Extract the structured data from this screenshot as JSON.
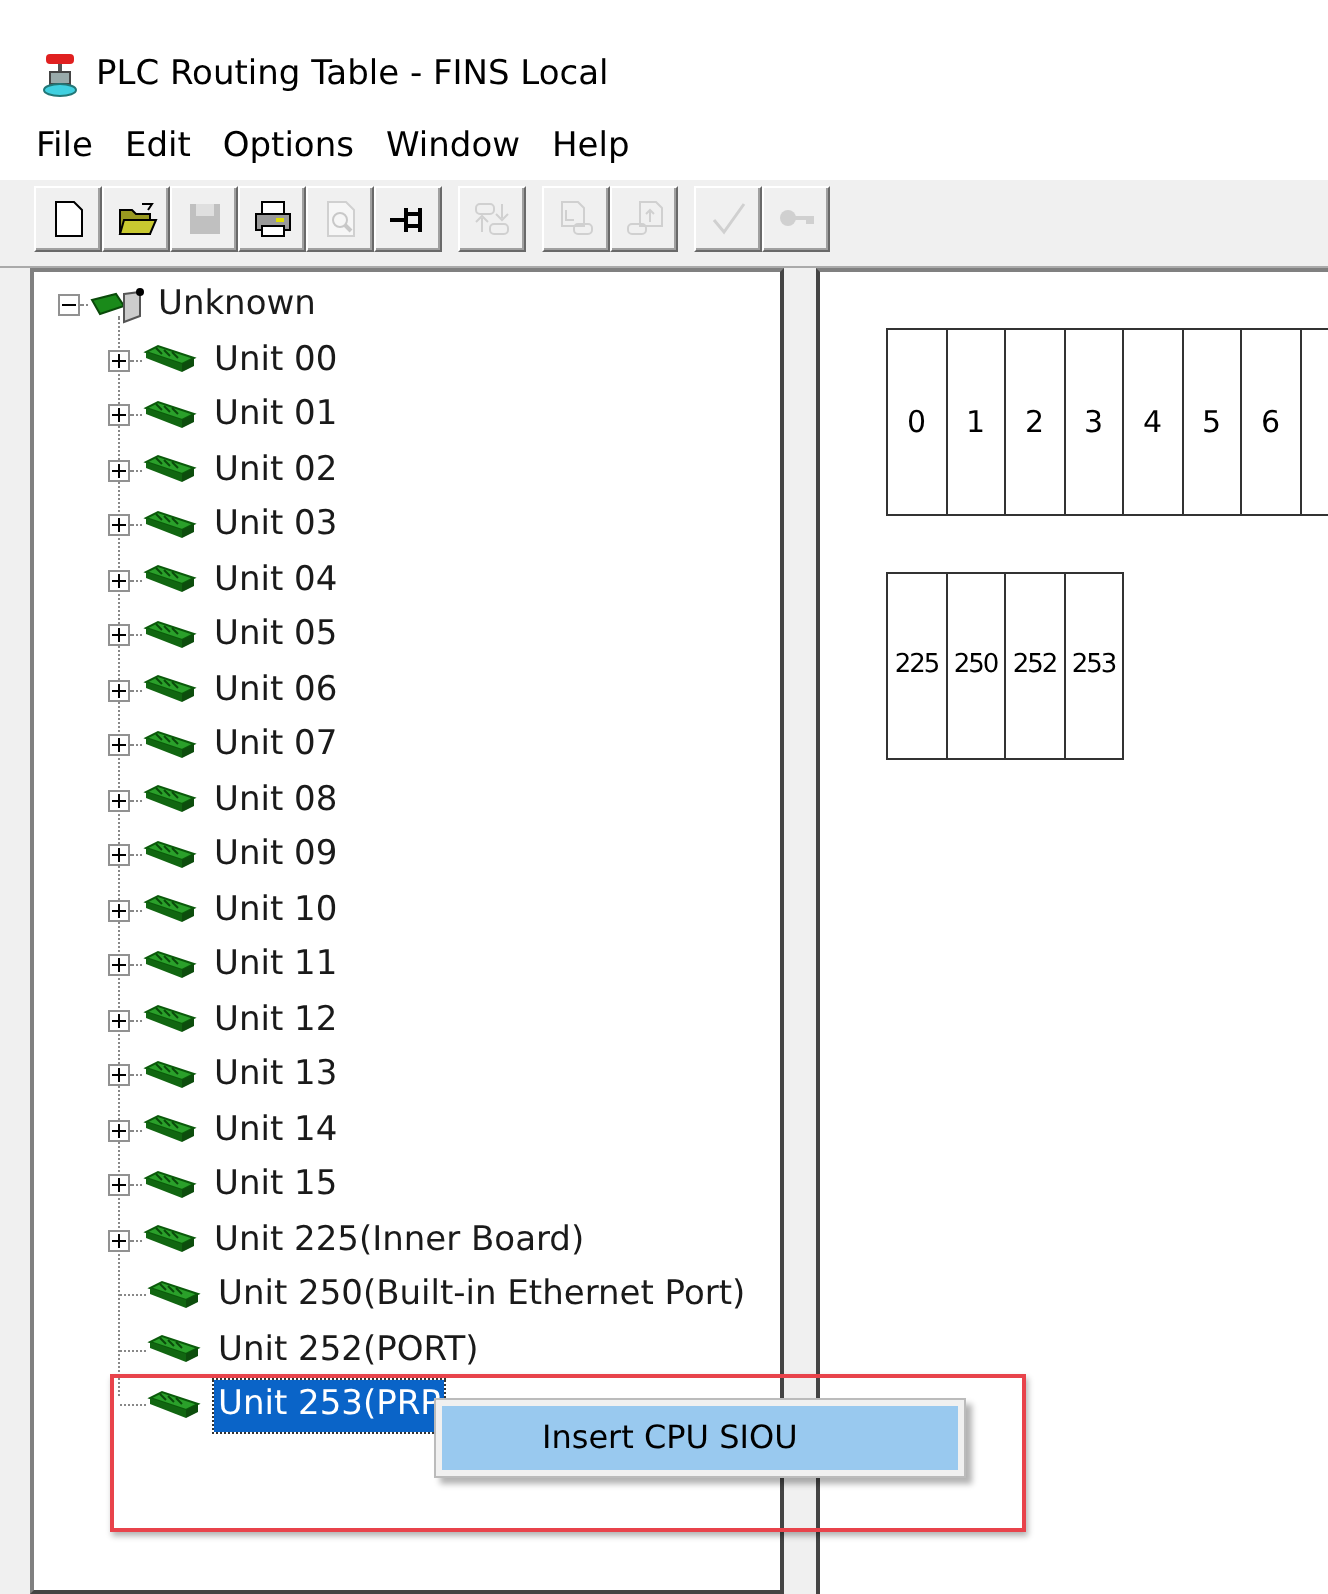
{
  "window": {
    "title": "PLC Routing Table - FINS Local"
  },
  "menu": [
    "File",
    "Edit",
    "Options",
    "Window",
    "Help"
  ],
  "toolbar": [
    [
      {
        "kind": "new",
        "disabled": false
      },
      {
        "kind": "open",
        "disabled": false
      },
      {
        "kind": "save",
        "disabled": true
      },
      {
        "kind": "print",
        "disabled": false
      },
      {
        "kind": "preview",
        "disabled": true
      },
      {
        "kind": "pin",
        "disabled": false
      }
    ],
    [
      {
        "kind": "transfer",
        "disabled": true
      }
    ],
    [
      {
        "kind": "download",
        "disabled": true
      },
      {
        "kind": "upload",
        "disabled": true
      }
    ],
    [
      {
        "kind": "check",
        "disabled": true
      },
      {
        "kind": "key",
        "disabled": true
      }
    ]
  ],
  "tree": {
    "label": "Unknown",
    "expanded": true,
    "children": [
      {
        "label": "Unit 00",
        "expandable": true,
        "selected": false
      },
      {
        "label": "Unit 01",
        "expandable": true,
        "selected": false
      },
      {
        "label": "Unit 02",
        "expandable": true,
        "selected": false
      },
      {
        "label": "Unit 03",
        "expandable": true,
        "selected": false
      },
      {
        "label": "Unit 04",
        "expandable": true,
        "selected": false
      },
      {
        "label": "Unit 05",
        "expandable": true,
        "selected": false
      },
      {
        "label": "Unit 06",
        "expandable": true,
        "selected": false
      },
      {
        "label": "Unit 07",
        "expandable": true,
        "selected": false
      },
      {
        "label": "Unit 08",
        "expandable": true,
        "selected": false
      },
      {
        "label": "Unit 09",
        "expandable": true,
        "selected": false
      },
      {
        "label": "Unit 10",
        "expandable": true,
        "selected": false
      },
      {
        "label": "Unit 11",
        "expandable": true,
        "selected": false
      },
      {
        "label": "Unit 12",
        "expandable": true,
        "selected": false
      },
      {
        "label": "Unit 13",
        "expandable": true,
        "selected": false
      },
      {
        "label": "Unit 14",
        "expandable": true,
        "selected": false
      },
      {
        "label": "Unit 15",
        "expandable": true,
        "selected": false
      },
      {
        "label": "Unit 225(Inner Board)",
        "expandable": true,
        "selected": false
      },
      {
        "label": "Unit 250(Built-in Ethernet Port)",
        "expandable": false,
        "selected": false
      },
      {
        "label": "Unit 252(PORT)",
        "expandable": false,
        "selected": false
      },
      {
        "label": "Unit 253(PRP",
        "expandable": false,
        "selected": true
      }
    ]
  },
  "rack_rows": [
    [
      "0",
      "1",
      "2",
      "3",
      "4",
      "5",
      "6",
      ""
    ],
    [
      "225",
      "250",
      "252",
      "253"
    ]
  ],
  "context_menu": [
    {
      "label": "Insert CPU SIOU",
      "selected": true
    }
  ]
}
